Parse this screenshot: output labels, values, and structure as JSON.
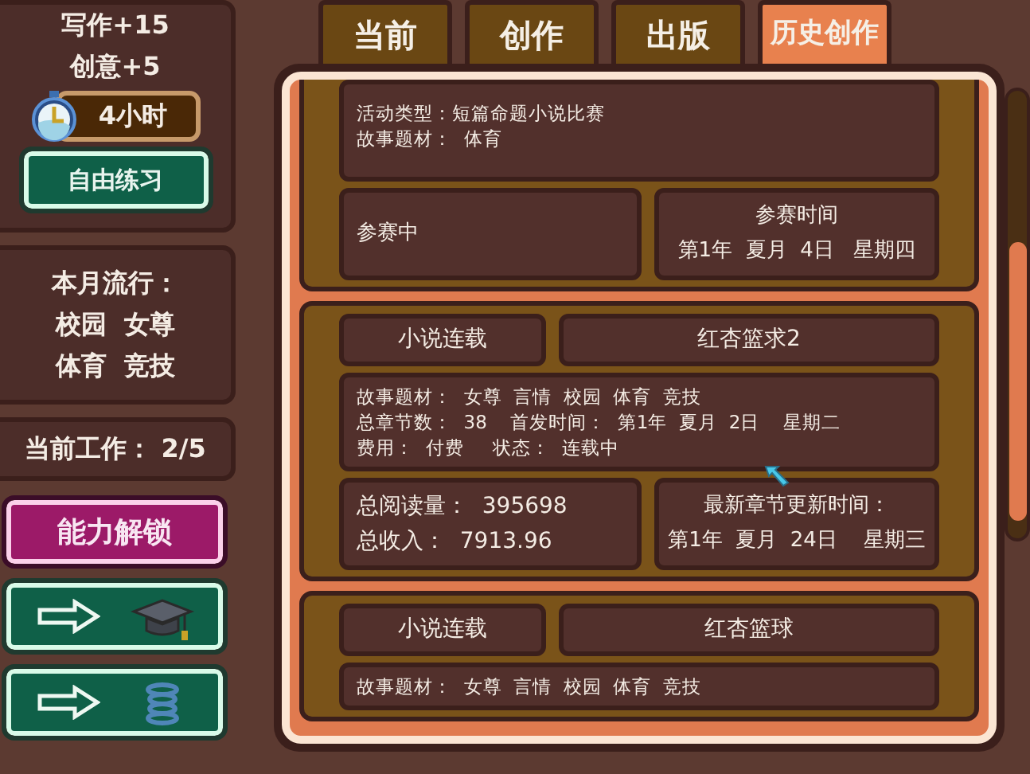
{
  "sidebar": {
    "stats": [
      "写作+15",
      "创意+5"
    ],
    "time": "4小时",
    "practice_button": "自由练习",
    "trend_title": "本月流行：",
    "trend_lines": [
      "校园  女尊",
      "体育  竞技"
    ],
    "work": "当前工作： 2/5",
    "unlock_button": "能力解锁",
    "nav_buttons": [
      {
        "kind": "cap"
      },
      {
        "kind": "spring"
      }
    ]
  },
  "tabs": [
    {
      "label": "当前",
      "selected": false
    },
    {
      "label": "创作",
      "selected": false
    },
    {
      "label": "出版",
      "selected": false
    },
    {
      "label": "历史创作",
      "selected": true
    }
  ],
  "records": [
    {
      "kind": "contest",
      "info": [
        "活动类型：短篇命题小说比赛",
        "故事题材：  体育"
      ],
      "status": "参赛中",
      "time_title": "参赛时间",
      "time": "第1年  夏月  4日   星期四"
    },
    {
      "kind": "serial",
      "type": "小说连载",
      "title": "红杏篮求2",
      "info": [
        "故事题材：  女尊  言情  校园  体育  竞技",
        "总章节数：  38    首发时间：  第1年  夏月  2日    星期二",
        "费用：  付费     状态：  连载中"
      ],
      "totals": [
        "总阅读量：  395698",
        "总收入：  7913.96"
      ],
      "update_title": "最新章节更新时间：",
      "update_time": "第1年  夏月  24日    星期三"
    },
    {
      "kind": "serial",
      "type": "小说连载",
      "title": "红杏篮球",
      "info": [
        "故事题材：  女尊  言情  校园  体育  竞技"
      ]
    }
  ]
}
